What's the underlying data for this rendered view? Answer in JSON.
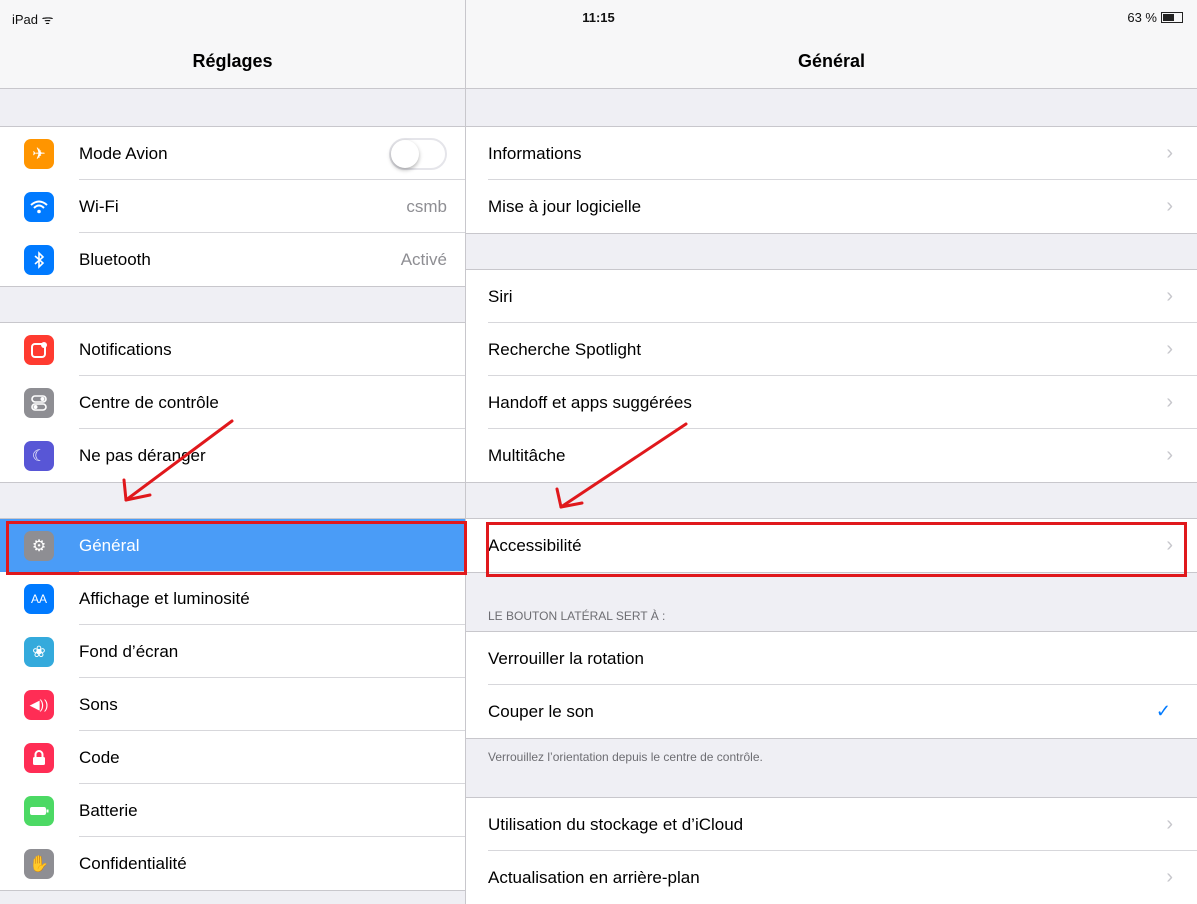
{
  "status_bar": {
    "device": "iPad",
    "time": "11:15",
    "battery": "63 %"
  },
  "left_nav": {
    "title": "Réglages"
  },
  "right_nav": {
    "title": "Général"
  },
  "settings": {
    "group1": [
      {
        "label": "Mode Avion",
        "icon": "airplane-icon",
        "color": "#ff9500",
        "toggle": false
      },
      {
        "label": "Wi-Fi",
        "icon": "wifi-icon",
        "color": "#007aff",
        "value": "csmb"
      },
      {
        "label": "Bluetooth",
        "icon": "bluetooth-icon",
        "color": "#007aff",
        "value": "Activé"
      }
    ],
    "group2": [
      {
        "label": "Notifications",
        "icon": "notifications-icon",
        "color": "#ff3b30"
      },
      {
        "label": "Centre de contrôle",
        "icon": "control-center-icon",
        "color": "#8e8e93"
      },
      {
        "label": "Ne pas déranger",
        "icon": "moon-icon",
        "color": "#5856d6"
      }
    ],
    "group3": [
      {
        "label": "Général",
        "icon": "gear-icon",
        "color": "#8e8e93",
        "selected": true
      },
      {
        "label": "Affichage et luminosité",
        "icon": "display-icon",
        "color": "#007aff"
      },
      {
        "label": "Fond d’écran",
        "icon": "wallpaper-icon",
        "color": "#34aadc"
      },
      {
        "label": "Sons",
        "icon": "sound-icon",
        "color": "#ff2d55"
      },
      {
        "label": "Code",
        "icon": "lock-icon",
        "color": "#ff2d55"
      },
      {
        "label": "Batterie",
        "icon": "battery-icon",
        "color": "#4cd964"
      },
      {
        "label": "Confidentialité",
        "icon": "hand-icon",
        "color": "#8e8e93"
      }
    ]
  },
  "general": {
    "group1": [
      "Informations",
      "Mise à jour logicielle"
    ],
    "group2": [
      "Siri",
      "Recherche Spotlight",
      "Handoff et apps suggérées",
      "Multitâche"
    ],
    "group3": [
      "Accessibilité"
    ],
    "side_switch_header": "LE BOUTON LATÉRAL SERT À :",
    "side_switch_options": [
      "Verrouiller la rotation",
      "Couper le son"
    ],
    "side_switch_footer": "Verrouillez l’orientation depuis le centre de contrôle.",
    "group5": [
      "Utilisation du stockage et d’iCloud",
      "Actualisation en arrière-plan"
    ]
  },
  "annotation_color": "#e0181c"
}
